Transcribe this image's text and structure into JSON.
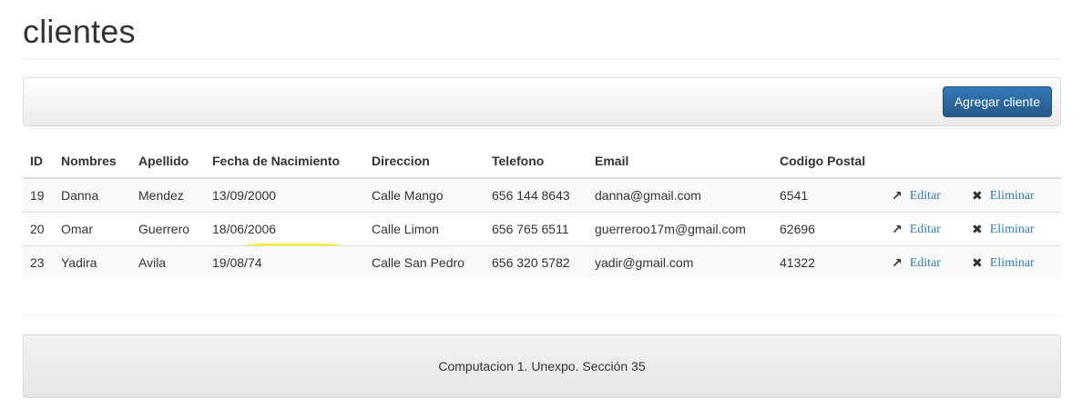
{
  "page": {
    "title": "clientes"
  },
  "toolbar": {
    "add_label": "Agregar cliente"
  },
  "table": {
    "headers": [
      "ID",
      "Nombres",
      "Apellido",
      "Fecha de Nacimiento",
      "Direccion",
      "Telefono",
      "Email",
      "Codigo Postal"
    ],
    "rows": [
      {
        "id": "19",
        "nombres": "Danna",
        "apellido": "Mendez",
        "fecha": "13/09/2000",
        "direccion": "Calle Mango",
        "telefono": "656 144 8643",
        "email": "danna@gmail.com",
        "cp": "6541",
        "editar": "Editar",
        "eliminar": "Eliminar"
      },
      {
        "id": "20",
        "nombres": "Omar",
        "apellido": "Guerrero",
        "fecha": "18/06/2006",
        "direccion": "Calle Limon",
        "telefono": "656 765 6511",
        "email": "guerreroo17m@gmail.com",
        "cp": "62696",
        "editar": "Editar",
        "eliminar": "Eliminar"
      },
      {
        "id": "23",
        "nombres": "Yadira",
        "apellido": "Avila",
        "fecha": "19/08/74",
        "direccion": "Calle San Pedro",
        "telefono": "656 320 5782",
        "email": "yadir@gmail.com",
        "cp": "41322",
        "editar": "Editar",
        "eliminar": "Eliminar"
      }
    ]
  },
  "icons": {
    "edit": "edit-icon",
    "delete": "close-icon"
  },
  "colors": {
    "highlight": "#f5f200",
    "link": "#337ab7",
    "button": "#2e6da4"
  },
  "footer": {
    "text": "Computacion 1. Unexpo. Sección 35"
  }
}
